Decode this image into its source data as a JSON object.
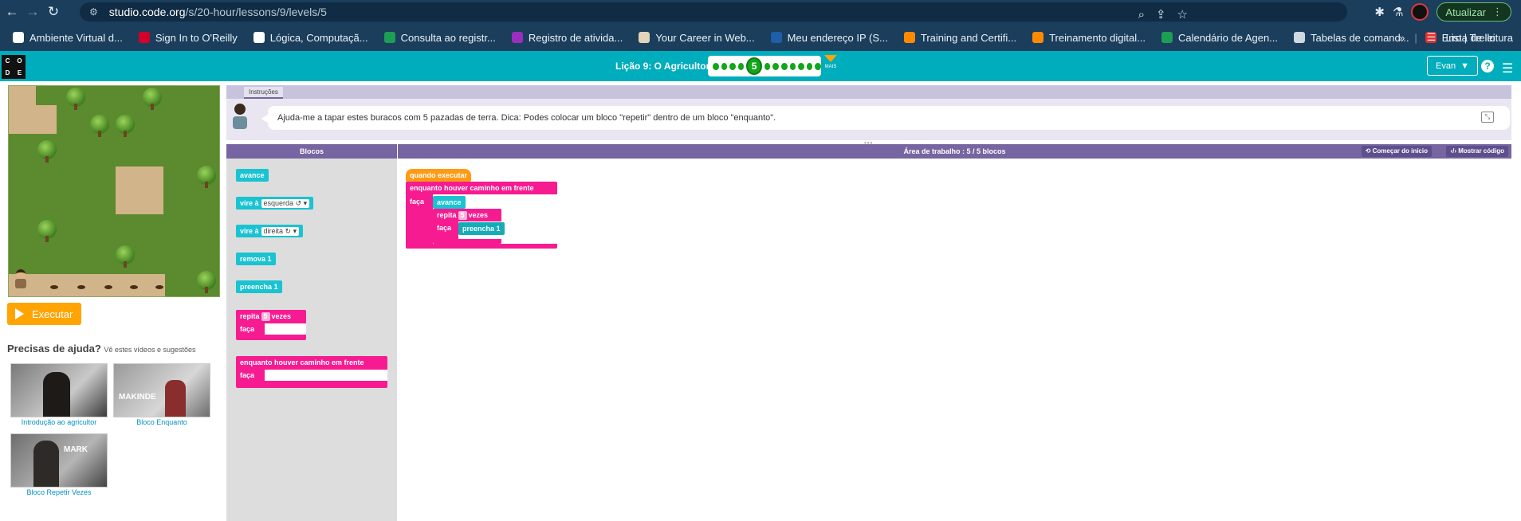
{
  "browser": {
    "url_host": "studio.code.org",
    "url_path": "/s/20-hour/lessons/9/levels/5",
    "update_label": "Atualizar",
    "bookmarks": [
      {
        "label": "Ambiente Virtual d...",
        "color": "#ffffff"
      },
      {
        "label": "Sign In to O'Reilly",
        "color": "#d3002d"
      },
      {
        "label": "Lógica, Computaçã...",
        "color": "#ffffff"
      },
      {
        "label": "Consulta ao registr...",
        "color": "#1e9d57"
      },
      {
        "label": "Registro de ativida...",
        "color": "#9a2fbf"
      },
      {
        "label": "Your Career in Web...",
        "color": "#e2d4b8"
      },
      {
        "label": "Meu endereço IP (S...",
        "color": "#1f5ea8"
      },
      {
        "label": "Training and Certifi...",
        "color": "#ff8a00"
      },
      {
        "label": "Treinamento digital...",
        "color": "#ff8a00"
      },
      {
        "label": "Calendário de Agen...",
        "color": "#1e9d57"
      },
      {
        "label": "Tabelas de comand...",
        "color": "#d0d8e0"
      },
      {
        "label": "Erro | Trello",
        "color": "#e0312f"
      }
    ],
    "reading_list": "Lista de leitura"
  },
  "header": {
    "logo_letters": [
      "C",
      "O",
      "D",
      "E"
    ],
    "lesson_title": "Lição 9: O Agricultor",
    "current_level": "5",
    "levels_before": 4,
    "levels_after": 7,
    "more_label": "MAIS",
    "user_name": "Evan"
  },
  "instructions": {
    "tab_label": "Instruções",
    "text": "Ajuda-me a tapar estes buracos com 5 pazadas de terra. Dica: Podes colocar um bloco \"repetir\" dentro de um bloco \"enquanto\"."
  },
  "run_button": "Executar",
  "help": {
    "title": "Precisas de ajuda?",
    "subtitle": "Vê estes vídeos e sugestões",
    "videos": [
      {
        "caption": "Introdução ao agricultor",
        "overlay": ""
      },
      {
        "caption": "Bloco Enquanto",
        "overlay": "MAKINDE"
      },
      {
        "caption": "Bloco Repetir Vezes",
        "overlay": "MARK"
      }
    ]
  },
  "toolbox": {
    "title": "Blocos",
    "blocks": {
      "avance": "avance",
      "vire_esq_label": "vire à",
      "vire_esq_dd": "esquerda ↺ ▾",
      "vire_dir_label": "vire à",
      "vire_dir_dd": "direita ↻ ▾",
      "remova": "remova 1",
      "preencha": "preencha 1",
      "repita_label": "repita",
      "repita_num": "5",
      "repita_vezes": "vezes",
      "faca": "faça",
      "enquanto": "enquanto houver caminho em frente"
    }
  },
  "workspace": {
    "title": "Área de trabalho : 5 / 5 blocos",
    "reset_label": "Começar do início",
    "show_code_label": "Mostrar código",
    "program": {
      "when_run": "quando executar",
      "while": "enquanto houver caminho em frente",
      "do": "faça",
      "move": "avance",
      "repeat": "repita",
      "repeat_num": "5",
      "times": "vezes",
      "fill": "preencha 1"
    }
  }
}
